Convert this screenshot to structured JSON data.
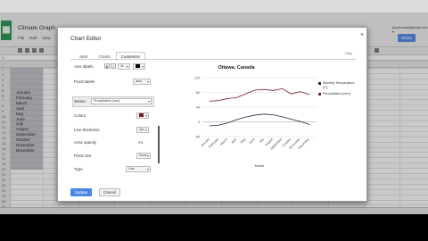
{
  "sheet": {
    "title": "Climate Graph",
    "menu": [
      "File",
      "Edit",
      "View"
    ],
    "email": "jmcdonald@gmail.com ▾",
    "share_label": "Share",
    "fx_label": "fx",
    "months": [
      "January",
      "February",
      "March",
      "April",
      "May",
      "June",
      "July",
      "August",
      "September",
      "October",
      "November",
      "December"
    ],
    "row_numbers": [
      "1",
      "2",
      "3",
      "4",
      "5",
      "6",
      "7",
      "8",
      "9",
      "10",
      "11",
      "12",
      "13",
      "14",
      "15",
      "16",
      "17",
      "18",
      "19",
      "20",
      "21",
      "22",
      "23",
      "24",
      "25",
      "26",
      "27"
    ]
  },
  "dialog": {
    "title": "Chart Editor",
    "close": "×",
    "help": "Help",
    "tabs": [
      "Start",
      "Charts",
      "Customize"
    ],
    "rows": {
      "axis_labels": "Axis labels",
      "point_labels": "Point labels",
      "series": "Series",
      "colour": "Colour",
      "line_thickness": "Line thickness",
      "area_opacity": "Area opacity",
      "point_size": "Point size",
      "type": "Type"
    },
    "values": {
      "font_size": "11",
      "point_labels": "auto",
      "series": "Precipitation (mm)",
      "line_thickness": "2px",
      "area_opacity": "0%",
      "point_size": "None",
      "type": "Line"
    },
    "update_label": "Update",
    "cancel_label": "Cancel",
    "colors": {
      "primary": "#4a86e8",
      "series_precip": "#7a1c24",
      "series_temp": "#1c2540"
    }
  },
  "chart_data": {
    "type": "line",
    "title": "Ottawa, Canada",
    "xlabel": "Month",
    "ylabel": "",
    "ylim": [
      -40,
      120
    ],
    "yticks": [
      "120",
      "80",
      "40",
      "0",
      "-40"
    ],
    "categories": [
      "January",
      "February",
      "March",
      "April",
      "May",
      "June",
      "July",
      "August",
      "September",
      "October",
      "November",
      "December"
    ],
    "series": [
      {
        "name": "Monthly Temperature (C)",
        "color": "#1c2540",
        "values": [
          -11,
          -9,
          -3,
          6,
          13,
          18,
          21,
          19,
          14,
          7,
          1,
          -7
        ]
      },
      {
        "name": "Precipitation (mm)",
        "color": "#7a1c24",
        "values": [
          56,
          58,
          63,
          66,
          76,
          86,
          88,
          85,
          90,
          76,
          82,
          74
        ]
      }
    ]
  }
}
